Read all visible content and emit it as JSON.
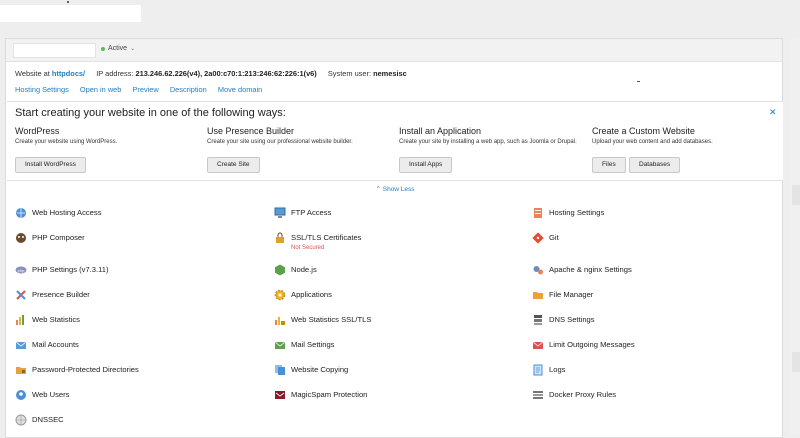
{
  "header": {
    "status": "Active"
  },
  "info": {
    "website_at_label": "Website at",
    "website_at_value": "httpdocs/",
    "ip_label": "IP address:",
    "ip_value": "213.246.62.226(v4), 2a00:c70:1:213:246:62:226:1(v6)",
    "user_label": "System user:",
    "user_value": "nemesisc"
  },
  "quicklinks": [
    "Hosting Settings",
    "Open in web",
    "Preview",
    "Description",
    "Move domain"
  ],
  "promo": {
    "title": "Start creating your website in one of the following ways:",
    "columns": [
      {
        "title": "WordPress",
        "desc": "Create your website using WordPress.",
        "buttons": [
          "Install WordPress"
        ]
      },
      {
        "title": "Use Presence Builder",
        "desc": "Create your site using our professional website builder.",
        "buttons": [
          "Create Site"
        ]
      },
      {
        "title": "Install an Application",
        "desc": "Create your site by installing a web app, such as Joomla or Drupal.",
        "buttons": [
          "Install Apps"
        ]
      },
      {
        "title": "Create a Custom Website",
        "desc": "Upload your web content and add databases.",
        "buttons": [
          "Files",
          "Databases"
        ]
      }
    ],
    "show_less": "Show Less"
  },
  "tools": [
    {
      "label": "Web Hosting Access",
      "icon": "globe-person-icon"
    },
    {
      "label": "FTP Access",
      "icon": "ftp-monitor-icon"
    },
    {
      "label": "Hosting Settings",
      "icon": "server-settings-icon"
    },
    {
      "label": "PHP Composer",
      "icon": "composer-icon"
    },
    {
      "label": "SSL/TLS Certificates",
      "sub": "Not Secured",
      "icon": "padlock-icon"
    },
    {
      "label": "Git",
      "icon": "git-icon"
    },
    {
      "label": "PHP Settings (v7.3.11)",
      "icon": "php-icon"
    },
    {
      "label": "Node.js",
      "icon": "nodejs-icon"
    },
    {
      "label": "Apache & nginx Settings",
      "icon": "gears-icon"
    },
    {
      "label": "Presence Builder",
      "icon": "builder-tools-icon"
    },
    {
      "label": "Applications",
      "icon": "applications-gear-icon"
    },
    {
      "label": "File Manager",
      "icon": "folder-icon"
    },
    {
      "label": "Web Statistics",
      "icon": "bar-chart-icon"
    },
    {
      "label": "Web Statistics SSL/TLS",
      "icon": "bar-chart-lock-icon"
    },
    {
      "label": "DNS Settings",
      "icon": "dns-icon"
    },
    {
      "label": "Mail Accounts",
      "icon": "envelope-icon"
    },
    {
      "label": "Mail Settings",
      "icon": "mail-settings-icon"
    },
    {
      "label": "Limit Outgoing Messages",
      "icon": "outgoing-mail-limit-icon"
    },
    {
      "label": "Password-Protected Directories",
      "icon": "locked-folder-icon"
    },
    {
      "label": "Website Copying",
      "icon": "copy-pages-icon"
    },
    {
      "label": "Logs",
      "icon": "logs-icon"
    },
    {
      "label": "Web Users",
      "icon": "web-users-icon"
    },
    {
      "label": "MagicSpam Protection",
      "icon": "magicspam-icon"
    },
    {
      "label": "Docker Proxy Rules",
      "icon": "docker-rules-icon"
    },
    {
      "label": "DNSSEC",
      "icon": "dnssec-globe-icon"
    }
  ],
  "colors": {
    "link": "#1e7fc2",
    "active_dot": "#5cb85c",
    "warning": "#d9534f"
  }
}
